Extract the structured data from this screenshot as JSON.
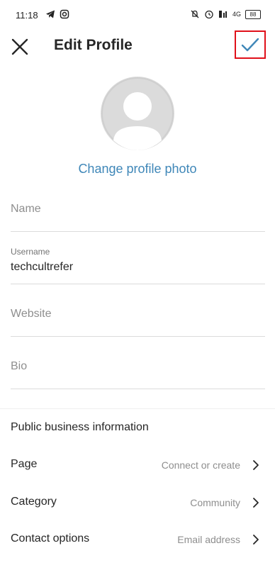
{
  "status_bar": {
    "time": "11:18",
    "left_icons": [
      "telegram-icon",
      "instagram-icon"
    ],
    "right_icons": [
      "mute-icon",
      "alarm-icon",
      "volte-icon",
      "signal-4g-icon",
      "battery-icon"
    ],
    "network_label": "4G",
    "battery_level": "88"
  },
  "header": {
    "title": "Edit Profile",
    "close_icon": "close-icon",
    "done_icon": "check-icon",
    "highlight_color": "#e0101a",
    "check_color": "#3f87b8"
  },
  "profile": {
    "change_photo_label": "Change profile photo"
  },
  "fields": {
    "name": {
      "placeholder": "Name"
    },
    "username": {
      "label": "Username",
      "value": "techcultrefer"
    },
    "website": {
      "placeholder": "Website"
    },
    "bio": {
      "placeholder": "Bio"
    }
  },
  "business": {
    "header": "Public business information",
    "rows": [
      {
        "label": "Page",
        "value": "Connect or create"
      },
      {
        "label": "Category",
        "value": "Community"
      },
      {
        "label": "Contact options",
        "value": "Email address"
      }
    ]
  }
}
